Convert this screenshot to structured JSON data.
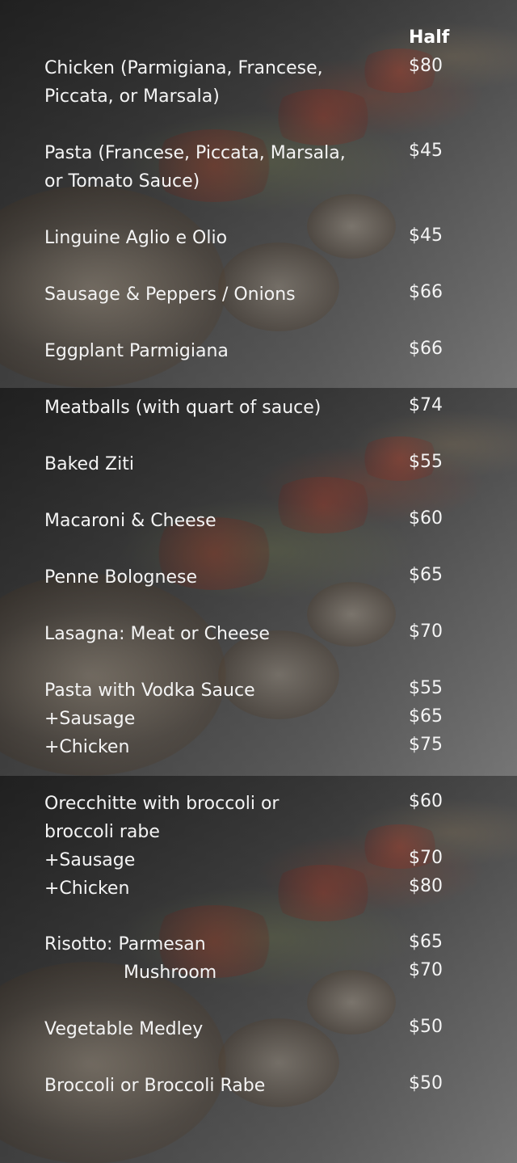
{
  "menu": {
    "column_header": "Half",
    "items": [
      {
        "name": "Chicken (Parmigiana, Francese,",
        "name2": "Piccata, or Marsala)",
        "price": "$80"
      },
      {
        "name": "Pasta (Francese, Piccata, Marsala,",
        "name2": "or Tomato Sauce)",
        "price": "$45"
      },
      {
        "name": "Linguine Aglio e Olio",
        "price": "$45"
      },
      {
        "name": "Sausage & Peppers / Onions",
        "price": "$66"
      },
      {
        "name": "Eggplant Parmigiana",
        "price": "$66"
      },
      {
        "name": "Meatballs (with quart of sauce)",
        "price": "$74"
      },
      {
        "name": "Baked Ziti",
        "price": "$55"
      },
      {
        "name": "Macaroni & Cheese",
        "price": "$60"
      },
      {
        "name": "Penne Bolognese",
        "price": "$65"
      },
      {
        "name": "Lasagna: Meat or Cheese",
        "price": "$70"
      },
      {
        "name": "Pasta with Vodka Sauce",
        "price": "$55",
        "addon1": "+Sausage",
        "addon1_price": "$65",
        "addon2": "+Chicken",
        "addon2_price": "$75"
      },
      {
        "name": "Orecchitte with broccoli or",
        "name2": "broccoli rabe",
        "price": "$60",
        "addon1": "+Sausage",
        "addon1_price": "$70",
        "addon2": "+Chicken",
        "addon2_price": "$80"
      },
      {
        "name": "Risotto: Parmesan",
        "price": "$65",
        "variant": "Mushroom",
        "variant_price": "$70"
      },
      {
        "name": "Vegetable Medley",
        "price": "$50"
      },
      {
        "name": "Broccoli or Broccoli Rabe",
        "price": "$50"
      }
    ]
  }
}
